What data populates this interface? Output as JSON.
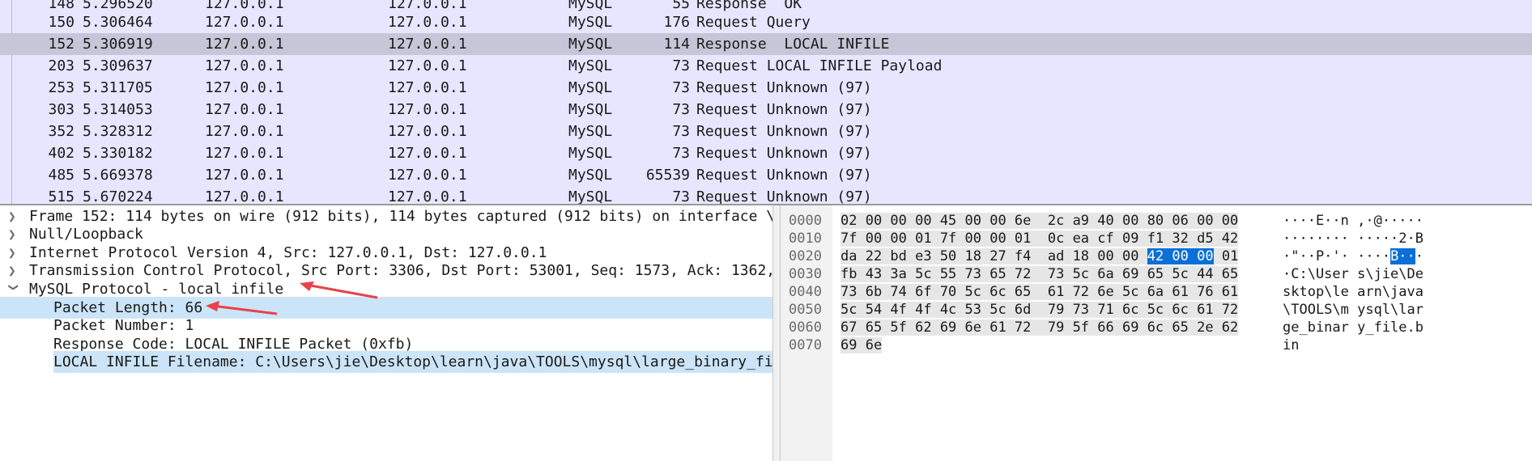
{
  "packets": [
    {
      "no": "148",
      "time": "5.296520",
      "src": "127.0.0.1",
      "dst": "127.0.0.1",
      "proto": "MySQL",
      "len": "55",
      "info": "Response  OK"
    },
    {
      "no": "150",
      "time": "5.306464",
      "src": "127.0.0.1",
      "dst": "127.0.0.1",
      "proto": "MySQL",
      "len": "176",
      "info": "Request Query"
    },
    {
      "no": "152",
      "time": "5.306919",
      "src": "127.0.0.1",
      "dst": "127.0.0.1",
      "proto": "MySQL",
      "len": "114",
      "info": "Response  LOCAL INFILE",
      "selected": true
    },
    {
      "no": "203",
      "time": "5.309637",
      "src": "127.0.0.1",
      "dst": "127.0.0.1",
      "proto": "MySQL",
      "len": "73",
      "info": "Request LOCAL INFILE Payload"
    },
    {
      "no": "253",
      "time": "5.311705",
      "src": "127.0.0.1",
      "dst": "127.0.0.1",
      "proto": "MySQL",
      "len": "73",
      "info": "Request Unknown (97)"
    },
    {
      "no": "303",
      "time": "5.314053",
      "src": "127.0.0.1",
      "dst": "127.0.0.1",
      "proto": "MySQL",
      "len": "73",
      "info": "Request Unknown (97)"
    },
    {
      "no": "352",
      "time": "5.328312",
      "src": "127.0.0.1",
      "dst": "127.0.0.1",
      "proto": "MySQL",
      "len": "73",
      "info": "Request Unknown (97)"
    },
    {
      "no": "402",
      "time": "5.330182",
      "src": "127.0.0.1",
      "dst": "127.0.0.1",
      "proto": "MySQL",
      "len": "73",
      "info": "Request Unknown (97)"
    },
    {
      "no": "485",
      "time": "5.669378",
      "src": "127.0.0.1",
      "dst": "127.0.0.1",
      "proto": "MySQL",
      "len": "65539",
      "info": "Request Unknown (97)"
    },
    {
      "no": "515",
      "time": "5.670224",
      "src": "127.0.0.1",
      "dst": "127.0.0.1",
      "proto": "MySQL",
      "len": "73",
      "info": "Request Unknown (97)"
    }
  ],
  "details": {
    "frame": "Frame 152: 114 bytes on wire (912 bits), 114 bytes captured (912 bits) on interface \\D",
    "null_loopback": "Null/Loopback",
    "ip": "Internet Protocol Version 4, Src: 127.0.0.1, Dst: 127.0.0.1",
    "tcp": "Transmission Control Protocol, Src Port: 3306, Dst Port: 53001, Seq: 1573, Ack: 1362,",
    "mysql": "MySQL Protocol - local infile",
    "packet_length": "Packet Length: 66",
    "packet_number": "Packet Number: 1",
    "response_code": "Response Code: LOCAL INFILE Packet (0xfb)",
    "filename": "LOCAL INFILE Filename: C:\\Users\\jie\\Desktop\\learn\\java\\TOOLS\\mysql\\large_binary_fil"
  },
  "bytes": [
    {
      "offset": "0000",
      "hex_a": "02 00 00 00 45 00 00 6e  2c a9 40 00 80 06 00 00",
      "ascii": "····E··n ,·@·····"
    },
    {
      "offset": "0010",
      "hex_a": "7f 00 00 01 7f 00 00 01  0c ea cf 09 f1 32 d5 42",
      "ascii": "········ ·····2·B"
    },
    {
      "offset": "0020",
      "hex_a": "da 22 bd e3 50 18 27 f4  ad 18 00 00 ",
      "hex_sel": "42 00 00",
      "hex_b": " 01",
      "ascii_a": "·\"··P·'· ····",
      "ascii_sel": "B··",
      "ascii_b": "·"
    },
    {
      "offset": "0030",
      "hex_a": "fb 43 3a 5c 55 73 65 72  73 5c 6a 69 65 5c 44 65",
      "ascii": "·C:\\User s\\jie\\De"
    },
    {
      "offset": "0040",
      "hex_a": "73 6b 74 6f 70 5c 6c 65  61 72 6e 5c 6a 61 76 61",
      "ascii": "sktop\\le arn\\java"
    },
    {
      "offset": "0050",
      "hex_a": "5c 54 4f 4f 4c 53 5c 6d  79 73 71 6c 5c 6c 61 72",
      "ascii": "\\TOOLS\\m ysql\\lar"
    },
    {
      "offset": "0060",
      "hex_a": "67 65 5f 62 69 6e 61 72  79 5f 66 69 6c 65 2e 62",
      "ascii": "ge_binar y_file.b"
    },
    {
      "offset": "0070",
      "hex_a": "69 6e",
      "ascii": "in"
    }
  ],
  "colors": {
    "list_bg": "#e7e6ff",
    "list_selected": "#c6c6d8",
    "detail_selected": "#cce4f7",
    "byte_selected": "#0a6fd6",
    "annotation_arrow": "#e8424b"
  }
}
